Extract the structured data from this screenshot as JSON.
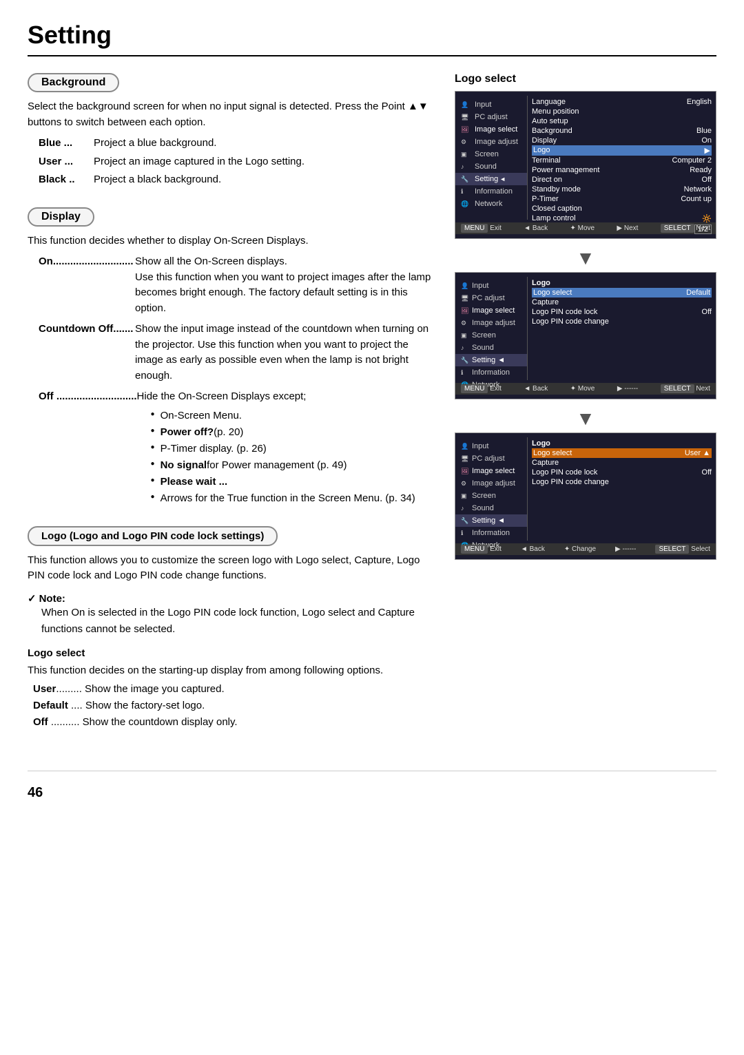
{
  "page": {
    "title": "Setting",
    "page_number": "46"
  },
  "background_section": {
    "label": "Background",
    "description": "Select the background screen for when no input signal is detected. Press the Point ▲▼ buttons to switch between each option.",
    "options": [
      {
        "key": "Blue",
        "dots": "...",
        "desc": "Project a blue background."
      },
      {
        "key": "User",
        "dots": "...",
        "desc": "Project an image captured in the Logo setting."
      },
      {
        "key": "Black",
        "dots": "..",
        "desc": "Project a black background."
      }
    ]
  },
  "display_section": {
    "label": "Display",
    "description": "This function decides whether to display On-Screen Displays.",
    "options": [
      {
        "key": "On",
        "dots": "......................",
        "desc": "Show all the On-Screen displays.\nUse this function when you want to project images after the lamp becomes bright enough. The factory default setting is in this option."
      },
      {
        "key": "Countdown Off",
        "dots": ".......",
        "desc": "Show the input image instead of the countdown when turning on the projector. Use this function when you want to project the image as early as possible even when the lamp is not bright enough."
      },
      {
        "key": "Off",
        "dots": "......................",
        "desc": "Hide the On-Screen Displays except;",
        "bullets": [
          "On-Screen Menu.",
          "Power off? (p. 20)",
          "P-Timer display. (p. 26)",
          "No signal for Power management (p. 49)",
          "Please wait ...",
          "Arrows for the True function in the Screen Menu. (p. 34)"
        ]
      }
    ]
  },
  "logo_section": {
    "label": "Logo (Logo and Logo PIN code lock settings)",
    "description": "This function allows you to customize the screen logo with Logo select, Capture, Logo PIN code lock and Logo PIN code change functions.",
    "note": {
      "title": "Note:",
      "content": "When On is selected in the Logo PIN code lock function, Logo select and Capture functions cannot be selected."
    },
    "logo_select": {
      "title": "Logo select",
      "description": "This function decides on the starting-up display from among following options.",
      "options": [
        {
          "key": "User",
          "dots": ".........",
          "desc": "Show the image you captured."
        },
        {
          "key": "Default",
          "dots": "....",
          "desc": "Show the factory-set logo."
        },
        {
          "key": "Off",
          "dots": "..........",
          "desc": "Show the countdown display only."
        }
      ]
    }
  },
  "right_col": {
    "logo_select_title": "Logo select",
    "menu1": {
      "left_items": [
        {
          "icon": "person",
          "label": "Input"
        },
        {
          "icon": "monitor",
          "label": "PC adjust"
        },
        {
          "icon": "image",
          "label": "Image select"
        },
        {
          "icon": "settings",
          "label": "Image adjust"
        },
        {
          "icon": "screen",
          "label": "Screen"
        },
        {
          "icon": "sound",
          "label": "Sound"
        },
        {
          "icon": "wrench",
          "label": "Setting",
          "active": true
        },
        {
          "icon": "info",
          "label": "Information"
        },
        {
          "icon": "network",
          "label": "Network"
        }
      ],
      "right_items": [
        {
          "label": "Language",
          "value": "English"
        },
        {
          "label": "Menu position",
          "value": ""
        },
        {
          "label": "Auto setup",
          "value": ""
        },
        {
          "label": "Background",
          "value": "Blue"
        },
        {
          "label": "Display",
          "value": "On"
        },
        {
          "label": "Logo",
          "value": "",
          "highlighted": true
        },
        {
          "label": "Terminal",
          "value": "Computer 2"
        },
        {
          "label": "Power management",
          "value": "Ready"
        },
        {
          "label": "Direct on",
          "value": "Off"
        },
        {
          "label": "Standby mode",
          "value": "Network"
        },
        {
          "label": "P-Timer",
          "value": "Count up"
        },
        {
          "label": "Closed caption",
          "value": ""
        },
        {
          "label": "Lamp control",
          "value": ""
        },
        {
          "label": "page",
          "value": "1/2"
        }
      ],
      "footer": {
        "exit": "Exit",
        "back": "Back",
        "move": "Move",
        "next": "Next",
        "select": "Next"
      }
    },
    "menu2": {
      "right_items": [
        {
          "label": "Logo",
          "value": "",
          "header": true
        },
        {
          "label": "Logo select",
          "value": "Default",
          "highlighted": true
        },
        {
          "label": "Capture",
          "value": ""
        },
        {
          "label": "Logo PIN code lock",
          "value": "Off"
        },
        {
          "label": "Logo PIN code change",
          "value": ""
        }
      ],
      "footer": {
        "exit": "Exit",
        "back": "Back",
        "move": "Move",
        "next": "------",
        "select": "Next"
      }
    },
    "menu3": {
      "right_items": [
        {
          "label": "Logo",
          "value": "",
          "header": true
        },
        {
          "label": "Logo select",
          "value": "User ▲",
          "highlighted": true,
          "orange": true
        },
        {
          "label": "Capture",
          "value": ""
        },
        {
          "label": "Logo PIN code lock",
          "value": "Off"
        },
        {
          "label": "Logo PIN code change",
          "value": ""
        }
      ],
      "footer": {
        "exit": "Exit",
        "back": "Back",
        "move": "Change",
        "next": "------",
        "select": "Select"
      }
    }
  }
}
